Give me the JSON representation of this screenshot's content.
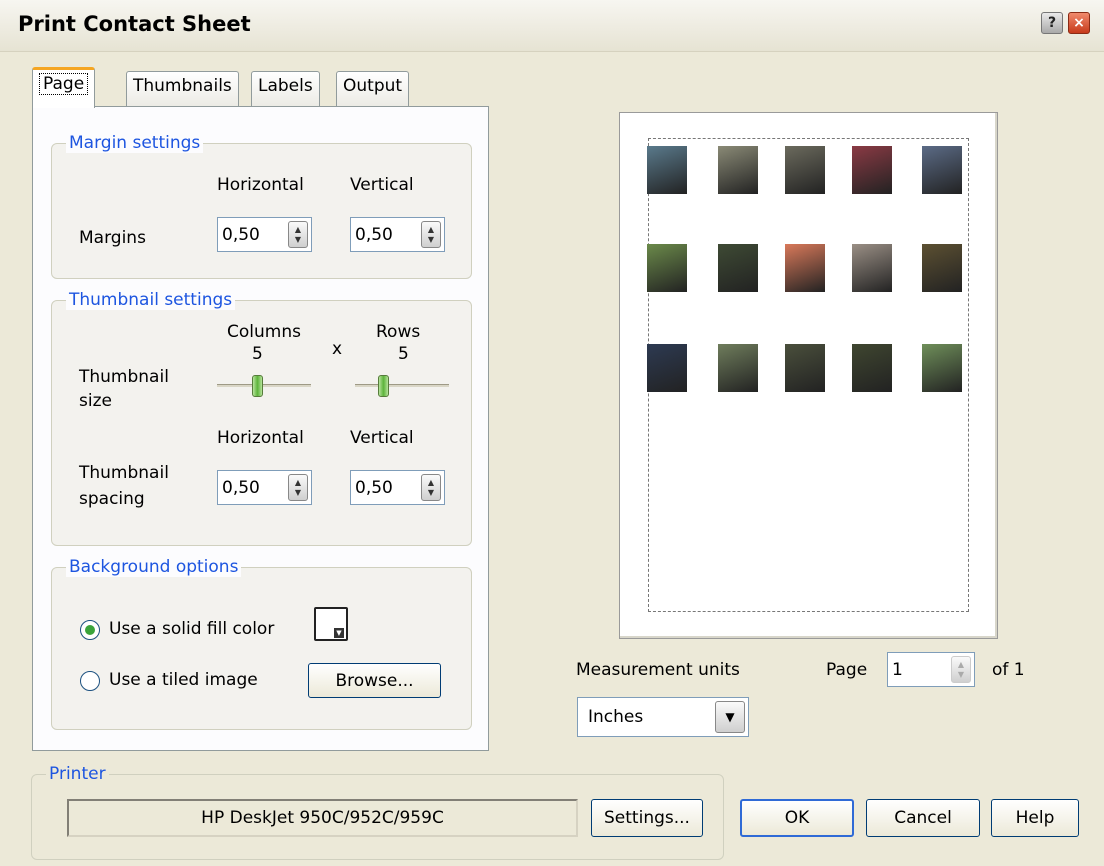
{
  "window": {
    "title": "Print Contact Sheet",
    "help_glyph": "?",
    "close_glyph": "×"
  },
  "tabs": [
    "Page",
    "Thumbnails",
    "Labels",
    "Output"
  ],
  "margin_settings": {
    "title": "Margin settings",
    "horizontal_label": "Horizontal",
    "vertical_label": "Vertical",
    "row_label": "Margins",
    "horizontal_value": "0,50",
    "vertical_value": "0,50"
  },
  "thumbnail_settings": {
    "title": "Thumbnail settings",
    "columns_label": "Columns",
    "rows_label": "Rows",
    "times_glyph": "x",
    "columns_value": "5",
    "rows_value": "5",
    "size_label_1": "Thumbnail",
    "size_label_2": "size",
    "columns_slider_fraction": 0.42,
    "rows_slider_fraction": 0.28,
    "horizontal_label": "Horizontal",
    "vertical_label": "Vertical",
    "spacing_label_1": "Thumbnail",
    "spacing_label_2": "spacing",
    "horizontal_value": "0,50",
    "vertical_value": "0,50"
  },
  "background_options": {
    "title": "Background options",
    "solid_fill_label": "Use a solid fill color",
    "tiled_image_label": "Use a tiled image",
    "browse_label": "Browse...",
    "selected": "solid_fill",
    "fill_color": "#ffffff"
  },
  "measurement": {
    "label": "Measurement units",
    "value": "Inches"
  },
  "pagination": {
    "page_label": "Page",
    "page_value": "1",
    "of_label": "of 1"
  },
  "printer": {
    "title": "Printer",
    "name": "HP DeskJet 950C/952C/959C",
    "settings_label": "Settings..."
  },
  "buttons": {
    "ok": "OK",
    "cancel": "Cancel",
    "help": "Help"
  },
  "thumbnail_colors": [
    "#5a7a8c",
    "#8a8a76",
    "#6b6a5d",
    "#8a3a44",
    "#5b6b86",
    "#6b8a4a",
    "#3e4a34",
    "#d9795a",
    "#9a8f85",
    "#5c5032",
    "#2d3a52",
    "#6f7d5c",
    "#4a4f3c",
    "#3f4630",
    "#6f8f5a"
  ]
}
